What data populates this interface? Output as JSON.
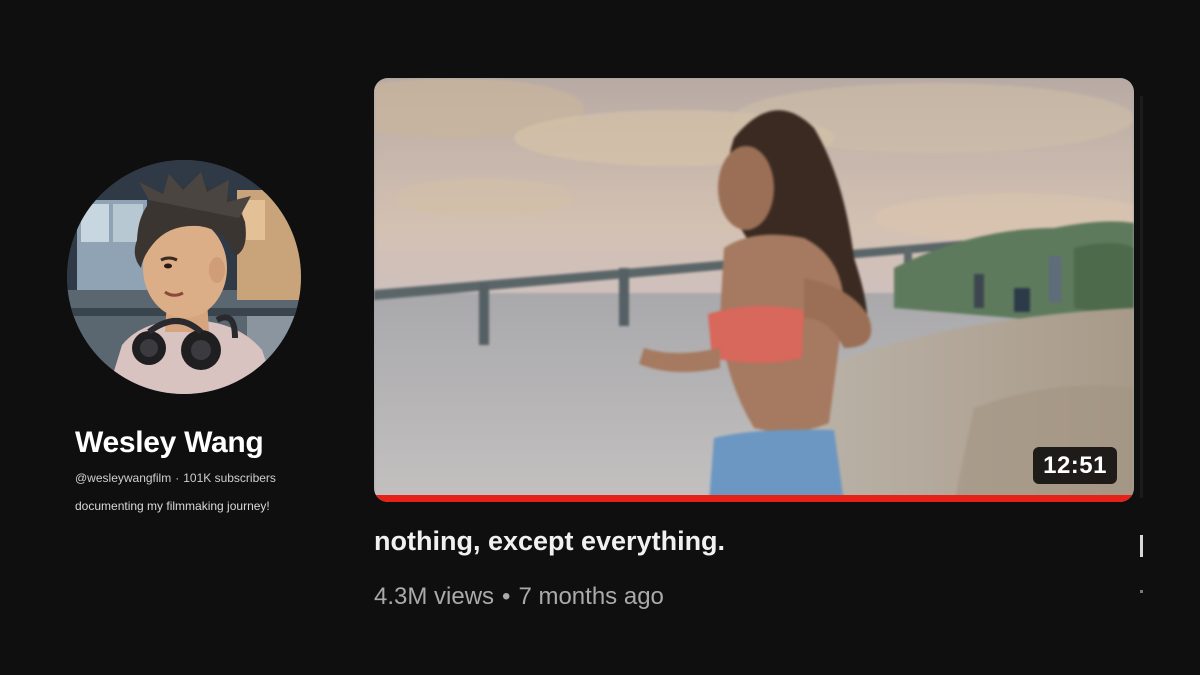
{
  "channel": {
    "name": "Wesley Wang",
    "handle": "@wesleywangfilm",
    "separator": "·",
    "subscribers": "101K subscribers",
    "description": "documenting my filmmaking journey!",
    "avatar_icon": "channel-avatar-photo"
  },
  "featured_video": {
    "title": "nothing, except everything.",
    "views": "4.3M views",
    "meta_separator": "•",
    "age": "7 months ago",
    "duration": "12:51",
    "watched_fraction": 1.0,
    "progress_color": "#e62117"
  },
  "theme": {
    "background": "#0f0f0f",
    "text_primary": "#f1f1f1",
    "text_secondary": "#aaaaaa"
  }
}
